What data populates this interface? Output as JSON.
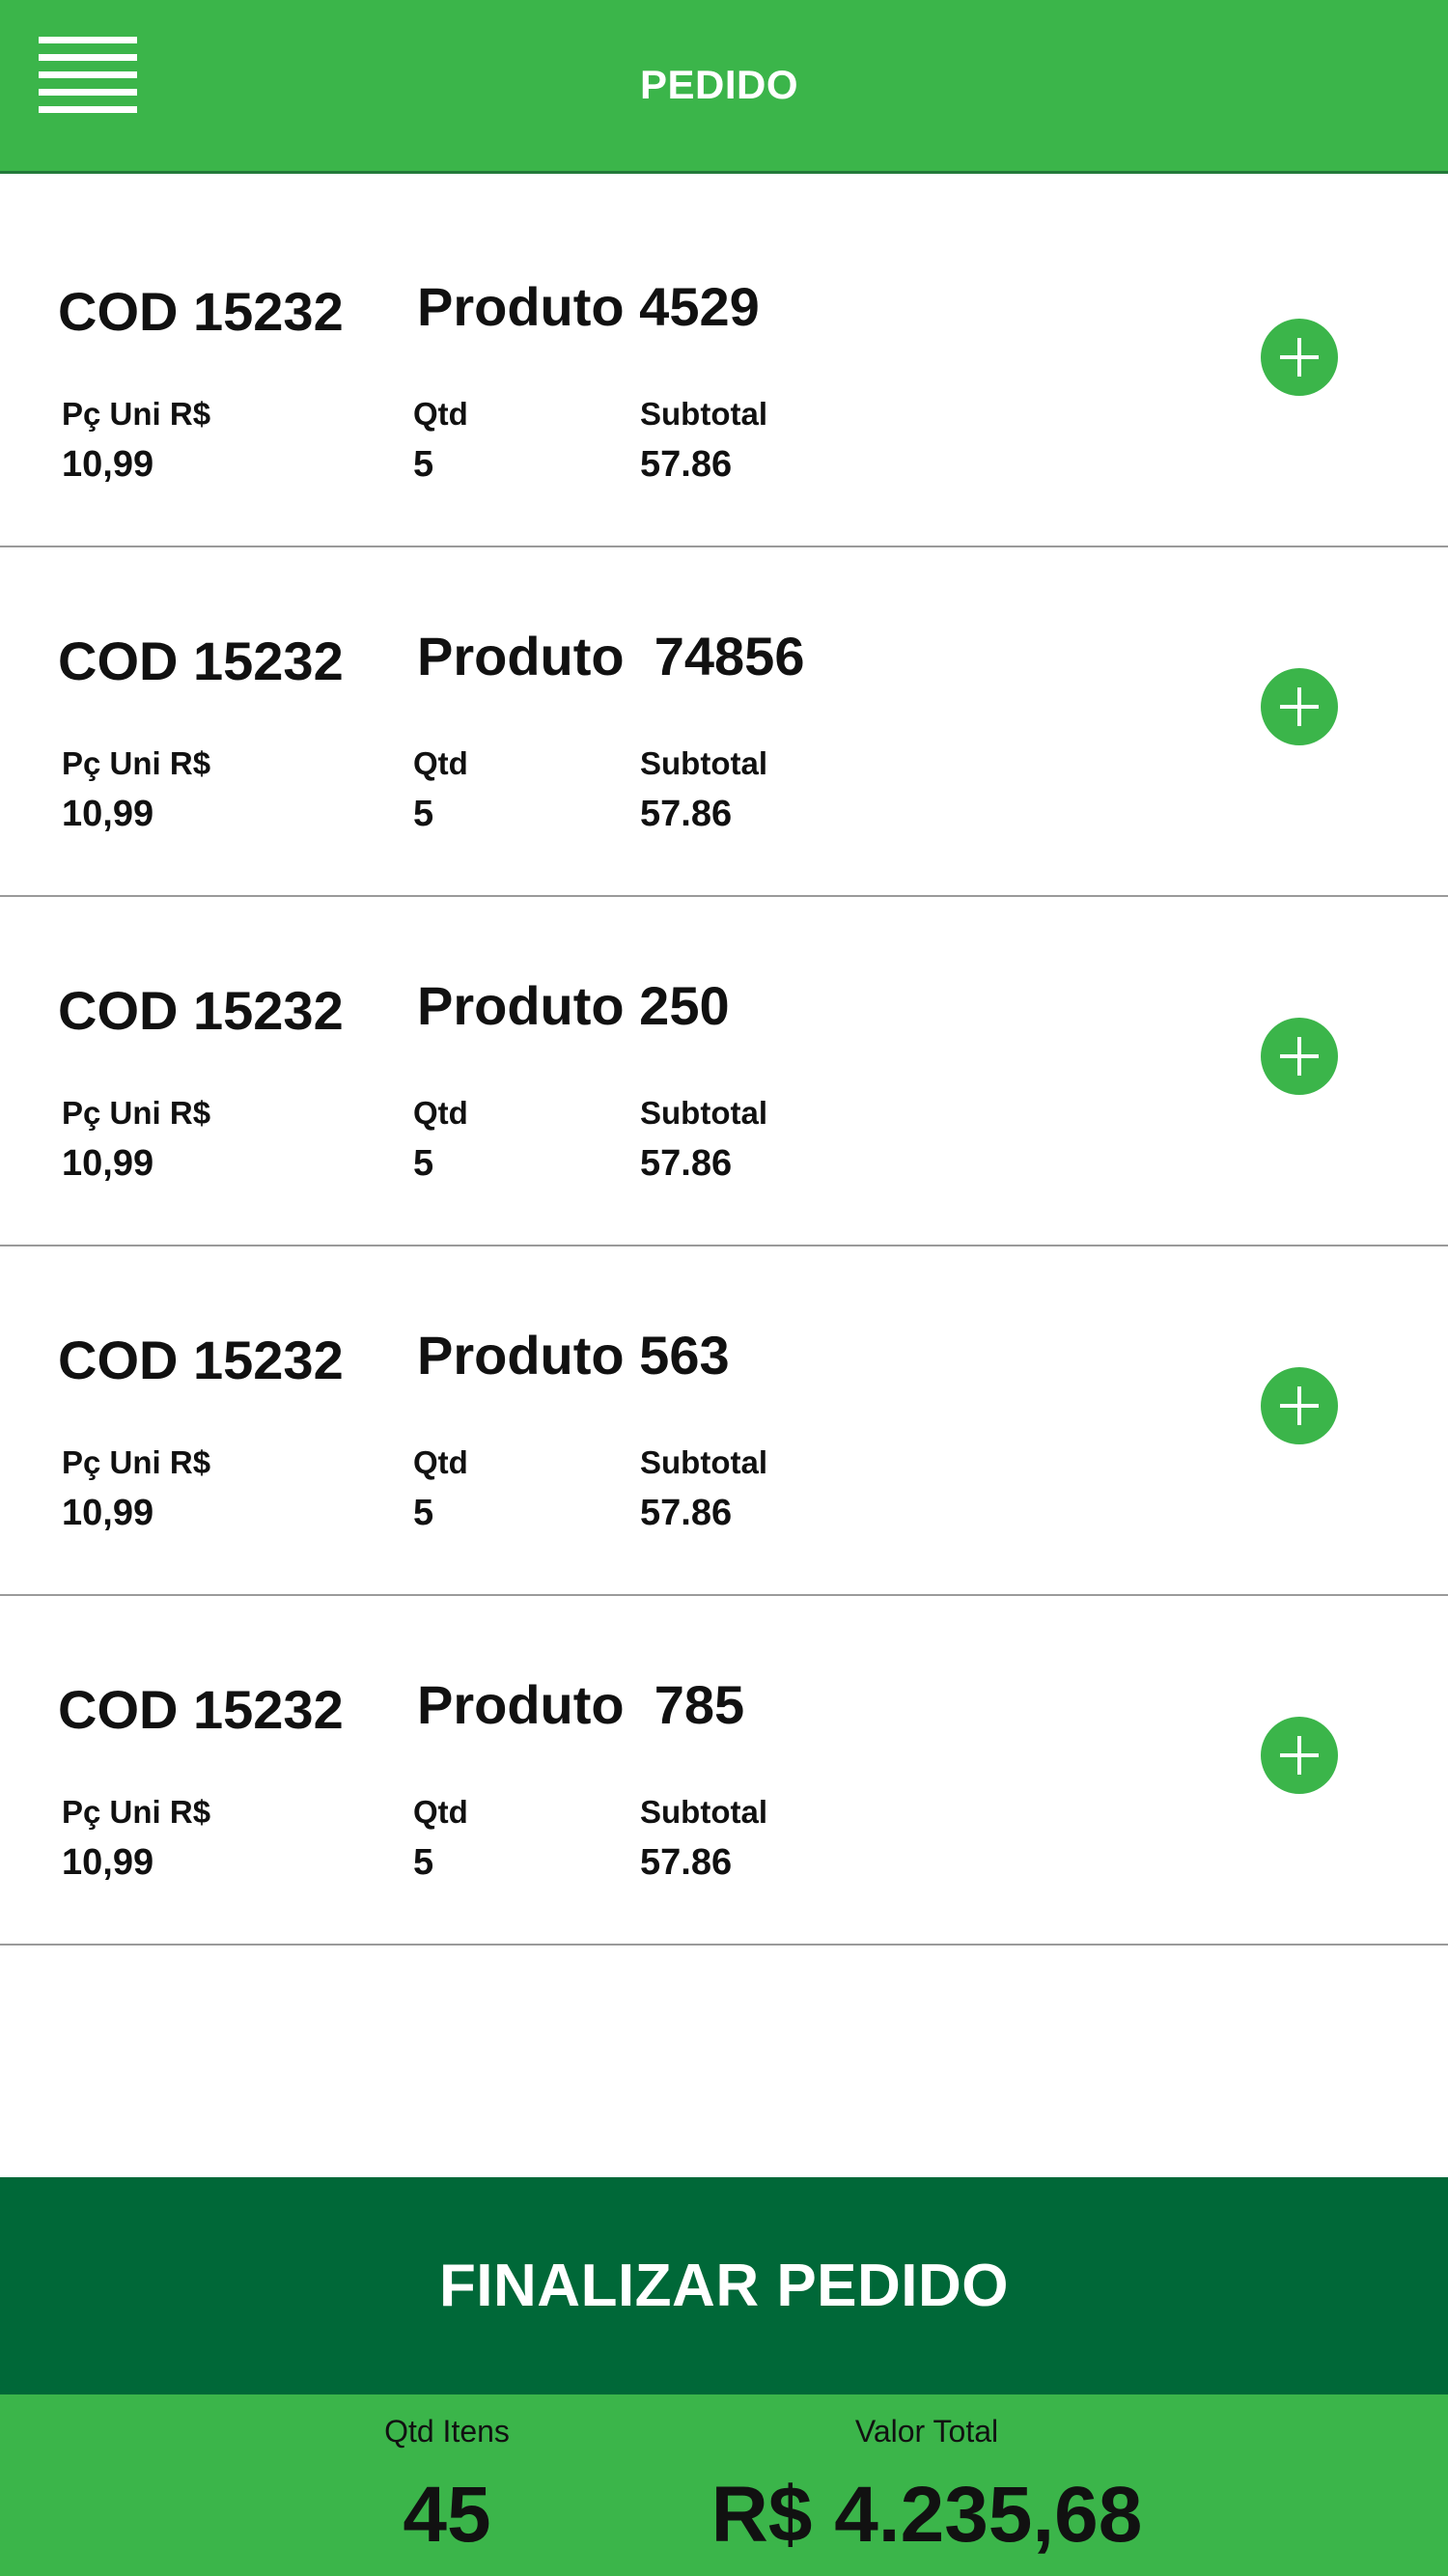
{
  "header": {
    "title": "PEDIDO",
    "menu_icon": "hamburger-menu-icon"
  },
  "labels": {
    "unit_price": "Pç Uni R$",
    "qty": "Qtd",
    "subtotal": "Subtotal"
  },
  "items": [
    {
      "code": "COD 15232",
      "product": "Produto 4529",
      "unit_price": "10,99",
      "qty": "5",
      "subtotal": "57.86"
    },
    {
      "code": "COD 15232",
      "product": "Produto  74856",
      "unit_price": "10,99",
      "qty": "5",
      "subtotal": "57.86"
    },
    {
      "code": "COD 15232",
      "product": "Produto 250",
      "unit_price": "10,99",
      "qty": "5",
      "subtotal": "57.86"
    },
    {
      "code": "COD 15232",
      "product": "Produto 563",
      "unit_price": "10,99",
      "qty": "5",
      "subtotal": "57.86"
    },
    {
      "code": "COD 15232",
      "product": "Produto  785",
      "unit_price": "10,99",
      "qty": "5",
      "subtotal": "57.86"
    }
  ],
  "finalize": {
    "label": "FINALIZAR PEDIDO"
  },
  "footer": {
    "qty_label": "Qtd Itens",
    "qty_value": "45",
    "total_label": "Valor Total",
    "total_value": "R$ 4.235,68"
  },
  "colors": {
    "primary_green": "#3bb54a",
    "dark_green": "#006838"
  }
}
